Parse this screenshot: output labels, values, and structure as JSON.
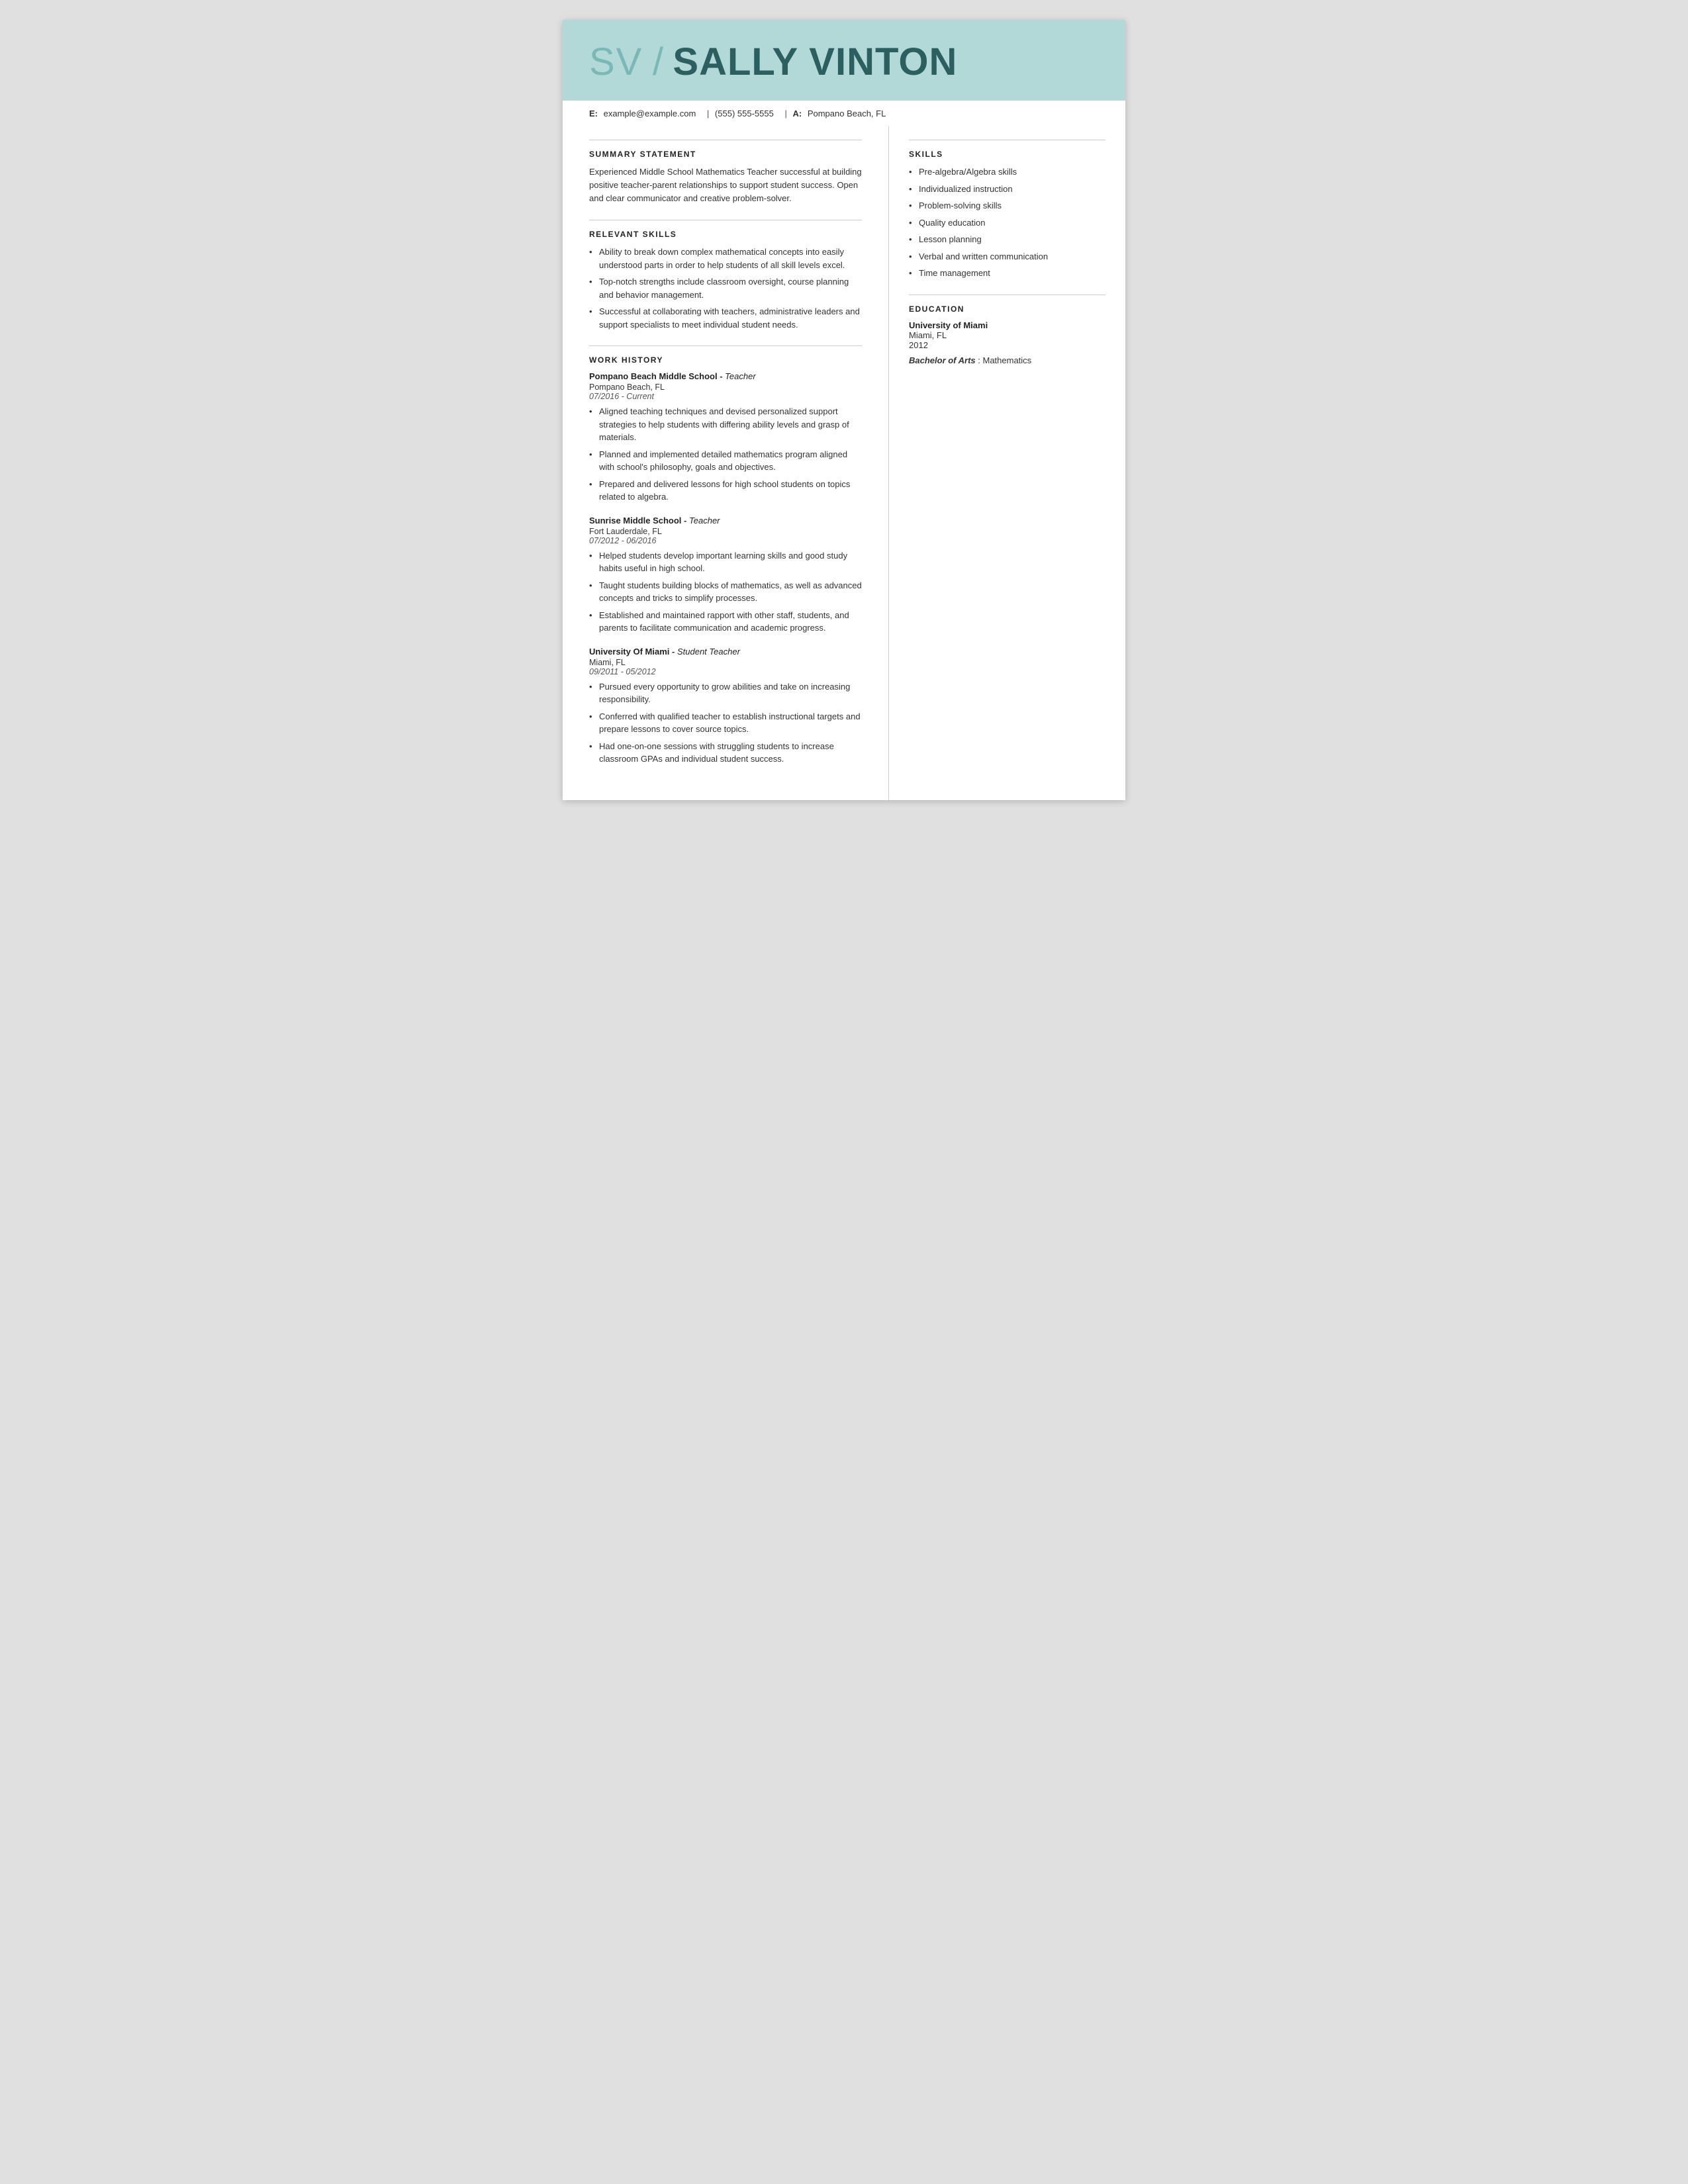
{
  "header": {
    "initials": "SV",
    "separator": "/",
    "name": "SALLY VINTON",
    "email_label": "E:",
    "email": "example@example.com",
    "phone": "(555) 555-5555",
    "address_label": "A:",
    "address": "Pompano Beach, FL"
  },
  "summary": {
    "section_title": "SUMMARY STATEMENT",
    "body": "Experienced Middle School Mathematics Teacher successful at building positive teacher-parent relationships to support student success. Open and clear communicator and creative problem-solver."
  },
  "relevant_skills": {
    "section_title": "RELEVANT SKILLS",
    "items": [
      "Ability to break down complex mathematical concepts into easily understood parts in order to help students of all skill levels excel.",
      "Top-notch strengths include classroom oversight, course planning and behavior management.",
      "Successful at collaborating with teachers, administrative leaders and support specialists to meet individual student needs."
    ]
  },
  "work_history": {
    "section_title": "WORK HISTORY",
    "jobs": [
      {
        "employer": "Pompano Beach Middle School",
        "role": "Teacher",
        "location": "Pompano Beach, FL",
        "dates": "07/2016 - Current",
        "bullets": [
          "Aligned teaching techniques and devised personalized support strategies to help students with differing ability levels and grasp of materials.",
          "Planned and implemented detailed mathematics program aligned with school's philosophy, goals and objectives.",
          "Prepared and delivered lessons for high school students on topics related to algebra."
        ]
      },
      {
        "employer": "Sunrise Middle School",
        "role": "Teacher",
        "location": "Fort Lauderdale, FL",
        "dates": "07/2012 - 06/2016",
        "bullets": [
          "Helped students develop important learning skills and good study habits useful in high school.",
          "Taught students building blocks of mathematics, as well as advanced concepts and tricks to simplify processes.",
          "Established and maintained rapport with other staff, students, and parents to facilitate communication and academic progress."
        ]
      },
      {
        "employer": "University Of Miami",
        "role": "Student Teacher",
        "location": "Miami, FL",
        "dates": "09/2011 - 05/2012",
        "bullets": [
          "Pursued every opportunity to grow abilities and take on increasing responsibility.",
          "Conferred with qualified teacher to establish instructional targets and prepare lessons to cover source topics.",
          "Had one-on-one sessions with struggling students to increase classroom GPAs and individual student success."
        ]
      }
    ]
  },
  "skills": {
    "section_title": "SKILLS",
    "items": [
      "Pre-algebra/Algebra skills",
      "Individualized instruction",
      "Problem-solving skills",
      "Quality education",
      "Lesson planning",
      "Verbal and written communication",
      "Time management"
    ]
  },
  "education": {
    "section_title": "EDUCATION",
    "schools": [
      {
        "name": "University of Miami",
        "location": "Miami, FL",
        "year": "2012",
        "degree_label": "Bachelor of Arts",
        "degree_field": "Mathematics"
      }
    ]
  }
}
